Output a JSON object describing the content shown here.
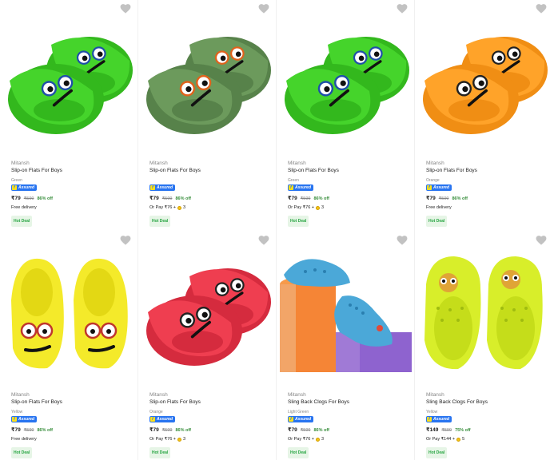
{
  "products": [
    {
      "brand": "Mitansh",
      "title": "Slip-on Flats For Boys",
      "color": "Green",
      "assured": "Assured",
      "price": "₹79",
      "mrp": "₹599",
      "off": "86% off",
      "sub_text": "Free delivery",
      "sub_coins": "",
      "deal": "Hot Deal",
      "image": "green-slides"
    },
    {
      "brand": "Mitansh",
      "title": "Slip-on Flats For Boys",
      "color": "",
      "assured": "Assured",
      "price": "₹79",
      "mrp": "₹599",
      "off": "86% off",
      "sub_text": "Or Pay ₹76 +",
      "sub_coins": "3",
      "deal": "Hot Deal",
      "image": "olive-slides"
    },
    {
      "brand": "Mitansh",
      "title": "Slip-on Flats For Boys",
      "color": "Green",
      "assured": "Assured",
      "price": "₹79",
      "mrp": "₹599",
      "off": "86% off",
      "sub_text": "Or Pay ₹76 +",
      "sub_coins": "3",
      "deal": "Hot Deal",
      "image": "green-slides"
    },
    {
      "brand": "Mitansh",
      "title": "Slip-on Flats For Boys",
      "color": "Orange",
      "assured": "Assured",
      "price": "₹79",
      "mrp": "₹599",
      "off": "86% off",
      "sub_text": "Free delivery",
      "sub_coins": "",
      "deal": "Hot Deal",
      "image": "orange-slides"
    },
    {
      "brand": "Mitansh",
      "title": "Slip-on Flats For Boys",
      "color": "Yellow",
      "assured": "Assured",
      "price": "₹79",
      "mrp": "₹599",
      "off": "86% off",
      "sub_text": "Free delivery",
      "sub_coins": "",
      "deal": "Hot Deal",
      "image": "yellow-slides"
    },
    {
      "brand": "Mitansh",
      "title": "Slip-on Flats For Boys",
      "color": "Orange",
      "assured": "Assured",
      "price": "₹79",
      "mrp": "₹599",
      "off": "86% off",
      "sub_text": "Or Pay ₹76 +",
      "sub_coins": "3",
      "deal": "Hot Deal",
      "image": "red-slides"
    },
    {
      "brand": "Mitansh",
      "title": "Sling Back Clogs For Boys",
      "color": "Light Green",
      "assured": "Assured",
      "price": "₹79",
      "mrp": "₹599",
      "off": "86% off",
      "sub_text": "Or Pay ₹76 +",
      "sub_coins": "3",
      "deal": "Hot Deal",
      "image": "blue-clogs"
    },
    {
      "brand": "Mitansh",
      "title": "Sling Back Clogs For Boys",
      "color": "Yellow",
      "assured": "Assured",
      "price": "₹149",
      "mrp": "₹599",
      "off": "75% off",
      "sub_text": "Or Pay ₹144 +",
      "sub_coins": "5",
      "deal": "Hot Deal",
      "image": "yellow-clogs"
    }
  ],
  "colors": {
    "accent": "#2874f0",
    "discount": "#388e3c",
    "deal_bg": "#e6f5e6",
    "deal_text": "#26a541",
    "muted": "#878787",
    "wishlist": "#c2c2c2"
  }
}
